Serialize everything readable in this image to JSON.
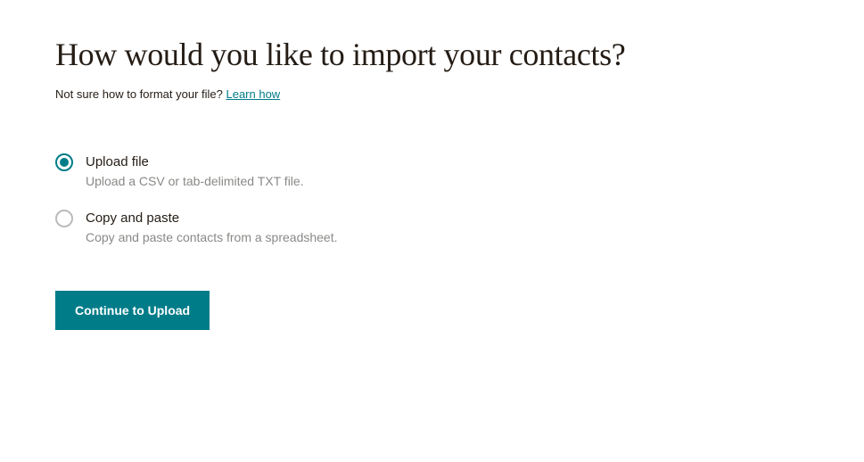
{
  "header": {
    "title": "How would you like to import your contacts?"
  },
  "sub": {
    "lead": "Not sure how to format your file? ",
    "link": "Learn how"
  },
  "options": [
    {
      "title": "Upload file",
      "desc": "Upload a CSV or tab-delimited TXT file.",
      "selected": true
    },
    {
      "title": "Copy and paste",
      "desc": "Copy and paste contacts from a spreadsheet.",
      "selected": false
    }
  ],
  "actions": {
    "continue": "Continue to Upload"
  },
  "colors": {
    "accent": "#007c89",
    "text": "#241c15",
    "muted": "#8a8987"
  }
}
